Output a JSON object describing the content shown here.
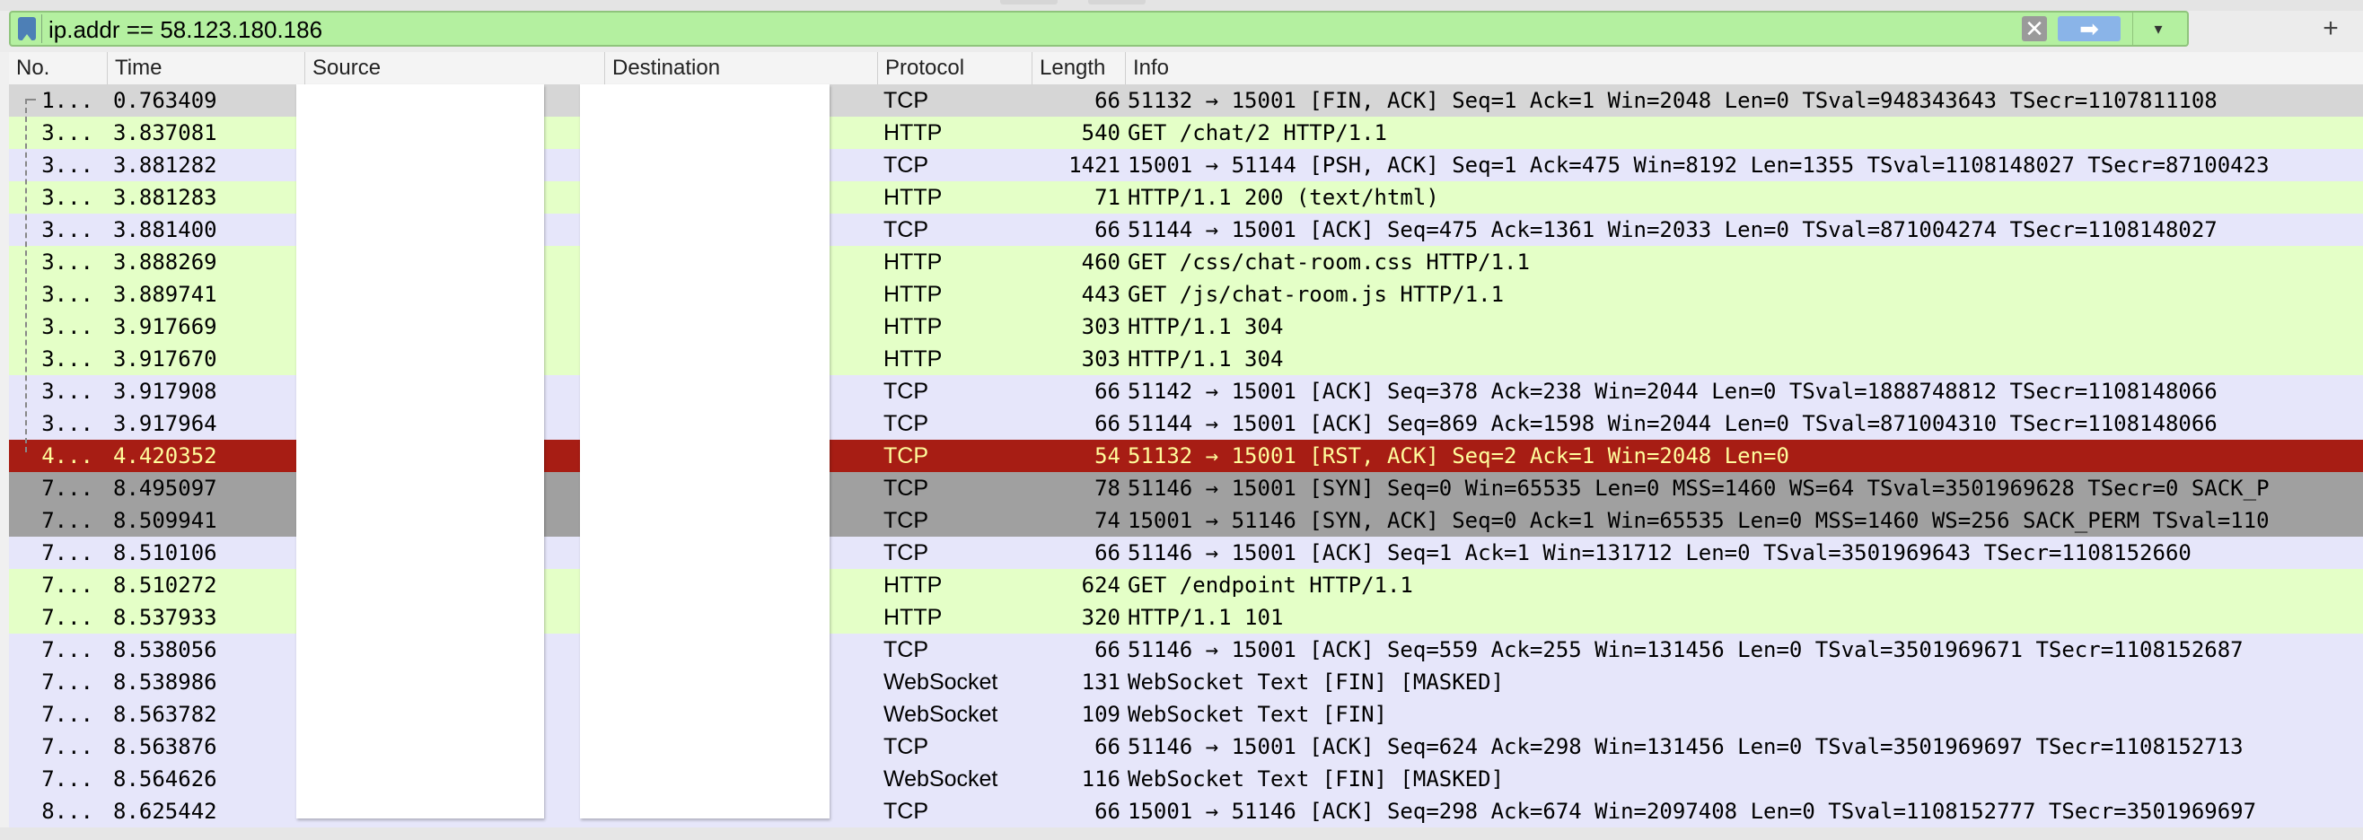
{
  "filter": {
    "value": "ip.addr == 58.123.180.186",
    "clear_icon": "clear-icon",
    "apply_icon": "arrow-right-icon",
    "dropdown_icon": "chevron-down-icon",
    "add_label": "+"
  },
  "columns": [
    "No.",
    "Time",
    "Source",
    "Destination",
    "Protocol",
    "Length",
    "Info"
  ],
  "colors": {
    "tcp": "#e6e6fa",
    "http": "#e4ffc7",
    "selected": "#d6d6d6",
    "rst": "#a71d14",
    "rst_text": "#fffc9c",
    "syn": "#a0a0a0"
  },
  "packets": [
    {
      "no": "1...",
      "time": "0.763409",
      "protocol": "TCP",
      "length": "66",
      "info": "51132 → 15001 [FIN, ACK] Seq=1 Ack=1 Win=2048 Len=0 TSval=948343643 TSecr=1107811108",
      "kind": "selected"
    },
    {
      "no": "3...",
      "time": "3.837081",
      "protocol": "HTTP",
      "length": "540",
      "info": "GET /chat/2 HTTP/1.1",
      "kind": "http"
    },
    {
      "no": "3...",
      "time": "3.881282",
      "protocol": "TCP",
      "length": "1421",
      "info": "15001 → 51144 [PSH, ACK] Seq=1 Ack=475 Win=8192 Len=1355 TSval=1108148027 TSecr=87100423",
      "kind": "tcp"
    },
    {
      "no": "3...",
      "time": "3.881283",
      "protocol": "HTTP",
      "length": "71",
      "info": "HTTP/1.1 200   (text/html)",
      "kind": "http"
    },
    {
      "no": "3...",
      "time": "3.881400",
      "protocol": "TCP",
      "length": "66",
      "info": "51144 → 15001 [ACK] Seq=475 Ack=1361 Win=2033 Len=0 TSval=871004274 TSecr=1108148027",
      "kind": "tcp"
    },
    {
      "no": "3...",
      "time": "3.888269",
      "protocol": "HTTP",
      "length": "460",
      "info": "GET /css/chat-room.css HTTP/1.1",
      "kind": "http"
    },
    {
      "no": "3...",
      "time": "3.889741",
      "protocol": "HTTP",
      "length": "443",
      "info": "GET /js/chat-room.js HTTP/1.1",
      "kind": "http"
    },
    {
      "no": "3...",
      "time": "3.917669",
      "protocol": "HTTP",
      "length": "303",
      "info": "HTTP/1.1 304",
      "kind": "http"
    },
    {
      "no": "3...",
      "time": "3.917670",
      "protocol": "HTTP",
      "length": "303",
      "info": "HTTP/1.1 304",
      "kind": "http"
    },
    {
      "no": "3...",
      "time": "3.917908",
      "protocol": "TCP",
      "length": "66",
      "info": "51142 → 15001 [ACK] Seq=378 Ack=238 Win=2044 Len=0 TSval=1888748812 TSecr=1108148066",
      "kind": "tcp"
    },
    {
      "no": "3...",
      "time": "3.917964",
      "protocol": "TCP",
      "length": "66",
      "info": "51144 → 15001 [ACK] Seq=869 Ack=1598 Win=2044 Len=0 TSval=871004310 TSecr=1108148066",
      "kind": "tcp"
    },
    {
      "no": "4...",
      "time": "4.420352",
      "protocol": "TCP",
      "length": "54",
      "info": "51132 → 15001 [RST, ACK] Seq=2 Ack=1 Win=2048 Len=0",
      "kind": "rst"
    },
    {
      "no": "7...",
      "time": "8.495097",
      "protocol": "TCP",
      "length": "78",
      "info": "51146 → 15001 [SYN] Seq=0 Win=65535 Len=0 MSS=1460 WS=64 TSval=3501969628 TSecr=0 SACK_P",
      "kind": "syn"
    },
    {
      "no": "7...",
      "time": "8.509941",
      "protocol": "TCP",
      "length": "74",
      "info": "15001 → 51146 [SYN, ACK] Seq=0 Ack=1 Win=65535 Len=0 MSS=1460 WS=256 SACK_PERM TSval=110",
      "kind": "syn"
    },
    {
      "no": "7...",
      "time": "8.510106",
      "protocol": "TCP",
      "length": "66",
      "info": "51146 → 15001 [ACK] Seq=1 Ack=1 Win=131712 Len=0 TSval=3501969643 TSecr=1108152660",
      "kind": "tcp"
    },
    {
      "no": "7...",
      "time": "8.510272",
      "protocol": "HTTP",
      "length": "624",
      "info": "GET /endpoint HTTP/1.1",
      "kind": "http"
    },
    {
      "no": "7...",
      "time": "8.537933",
      "protocol": "HTTP",
      "length": "320",
      "info": "HTTP/1.1 101",
      "kind": "http"
    },
    {
      "no": "7...",
      "time": "8.538056",
      "protocol": "TCP",
      "length": "66",
      "info": "51146 → 15001 [ACK] Seq=559 Ack=255 Win=131456 Len=0 TSval=3501969671 TSecr=1108152687",
      "kind": "tcp"
    },
    {
      "no": "7...",
      "time": "8.538986",
      "protocol": "WebSocket",
      "length": "131",
      "info": "WebSocket Text [FIN] [MASKED]",
      "kind": "tcp"
    },
    {
      "no": "7...",
      "time": "8.563782",
      "protocol": "WebSocket",
      "length": "109",
      "info": "WebSocket Text [FIN]",
      "kind": "tcp"
    },
    {
      "no": "7...",
      "time": "8.563876",
      "protocol": "TCP",
      "length": "66",
      "info": "51146 → 15001 [ACK] Seq=624 Ack=298 Win=131456 Len=0 TSval=3501969697 TSecr=1108152713",
      "kind": "tcp"
    },
    {
      "no": "7...",
      "time": "8.564626",
      "protocol": "WebSocket",
      "length": "116",
      "info": "WebSocket Text [FIN] [MASKED]",
      "kind": "tcp"
    },
    {
      "no": "8...",
      "time": "8.625442",
      "protocol": "TCP",
      "length": "66",
      "info": "15001 → 51146 [ACK] Seq=298 Ack=674 Win=2097408 Len=0 TSval=1108152777 TSecr=3501969697",
      "kind": "tcp"
    }
  ]
}
